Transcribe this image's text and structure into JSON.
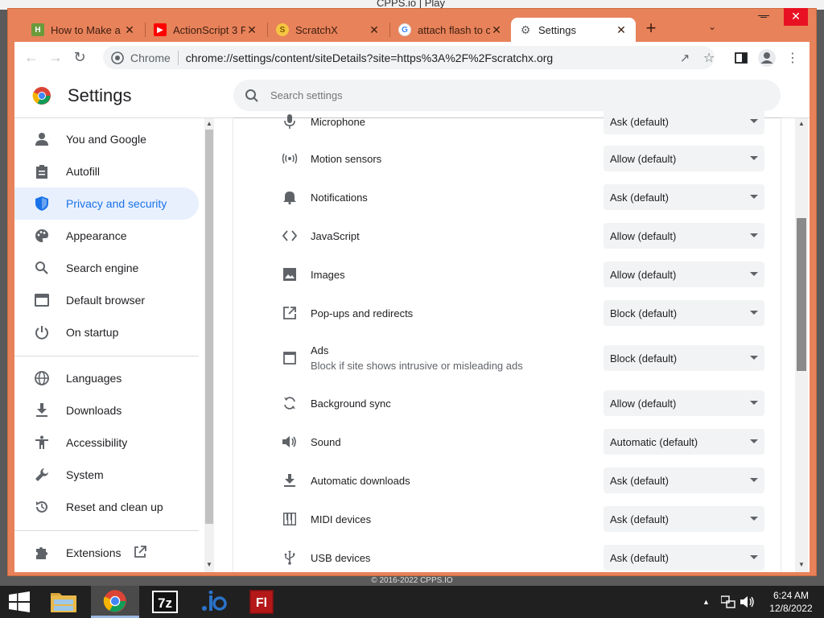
{
  "background_title": "CPPS.io | Play",
  "tabs": [
    {
      "label": "How to Make a",
      "icon": "h-site-favicon"
    },
    {
      "label": "ActionScript 3 P",
      "icon": "youtube-favicon"
    },
    {
      "label": "ScratchX",
      "icon": "scratchx-favicon"
    },
    {
      "label": "attach flash to c",
      "icon": "google-favicon"
    },
    {
      "label": "Settings",
      "icon": "gear-favicon",
      "active": true
    }
  ],
  "toolbar": {
    "site_label": "Chrome",
    "url_prefix": "chrome://",
    "url_path": "settings/content/siteDetails?site=https%3A%2F%2Fscratchx.org"
  },
  "settings": {
    "title": "Settings",
    "search_placeholder": "Search settings"
  },
  "sidebar": {
    "items": [
      {
        "label": "You and Google",
        "icon": "person-icon"
      },
      {
        "label": "Autofill",
        "icon": "clipboard-icon"
      },
      {
        "label": "Privacy and security",
        "icon": "shield-icon",
        "selected": true
      },
      {
        "label": "Appearance",
        "icon": "palette-icon"
      },
      {
        "label": "Search engine",
        "icon": "search-icon"
      },
      {
        "label": "Default browser",
        "icon": "browser-window-icon"
      },
      {
        "label": "On startup",
        "icon": "power-icon"
      },
      {
        "label": "Languages",
        "icon": "globe-icon"
      },
      {
        "label": "Downloads",
        "icon": "download-icon"
      },
      {
        "label": "Accessibility",
        "icon": "accessibility-icon"
      },
      {
        "label": "System",
        "icon": "wrench-icon"
      },
      {
        "label": "Reset and clean up",
        "icon": "reset-icon"
      },
      {
        "label": "Extensions",
        "icon": "puzzle-icon"
      }
    ]
  },
  "permissions": [
    {
      "label": "Microphone",
      "value": "Ask (default)",
      "icon": "microphone-icon"
    },
    {
      "label": "Motion sensors",
      "value": "Allow (default)",
      "icon": "motion-sensor-icon"
    },
    {
      "label": "Notifications",
      "value": "Ask (default)",
      "icon": "bell-icon"
    },
    {
      "label": "JavaScript",
      "value": "Allow (default)",
      "icon": "code-icon"
    },
    {
      "label": "Images",
      "value": "Allow (default)",
      "icon": "image-icon"
    },
    {
      "label": "Pop-ups and redirects",
      "value": "Block (default)",
      "icon": "popup-icon"
    },
    {
      "label": "Ads",
      "sublabel": "Block if site shows intrusive or misleading ads",
      "value": "Block (default)",
      "icon": "ads-window-icon"
    },
    {
      "label": "Background sync",
      "value": "Allow (default)",
      "icon": "sync-icon"
    },
    {
      "label": "Sound",
      "value": "Automatic (default)",
      "icon": "volume-icon"
    },
    {
      "label": "Automatic downloads",
      "value": "Ask (default)",
      "icon": "download-icon"
    },
    {
      "label": "MIDI devices",
      "value": "Ask (default)",
      "icon": "piano-icon"
    },
    {
      "label": "USB devices",
      "value": "Ask (default)",
      "icon": "usb-icon"
    }
  ],
  "footer_text": "© 2016-2022 CPPS.IO",
  "taskbar": {
    "apps": [
      "file-explorer-icon",
      "chrome-icon",
      "7zip-icon",
      "io-app-icon",
      "flash-icon"
    ],
    "time": "6:24 AM",
    "date": "12/8/2022"
  },
  "colors": {
    "titlebar": "#e8825a",
    "accent": "#1a73e8",
    "selected_bg": "#e8f0fe"
  }
}
